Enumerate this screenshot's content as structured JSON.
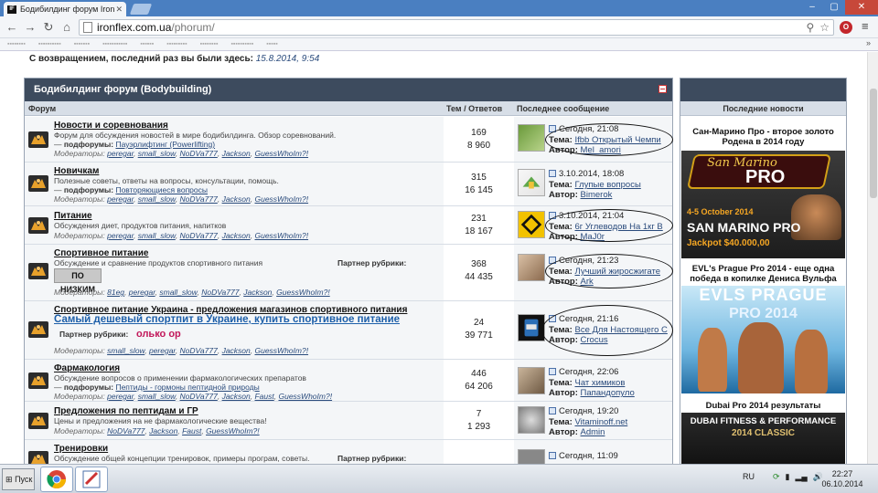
{
  "browser": {
    "tab_title": "Бодибилдинг форум IronFle",
    "url_host": "ironflex.com.ua",
    "url_path": "/phorum/"
  },
  "page": {
    "welcome": "С возвращением, последний раз вы были здесь:",
    "last_visit": "15.8.2014, 9:54",
    "section_title": "Бодибилдинг форум (Bodybuilding)",
    "col_forum": "Форум",
    "col_stats": "Тем / Ответов",
    "col_last": "Последнее сообщение",
    "topic_label": "Тема:",
    "author_label": "Автор:",
    "subforums_label": "подфорумы:",
    "moderators_label": "Модераторы:",
    "partner_label": "Партнер рубрики:"
  },
  "forums": [
    {
      "name": "Новости и соревнования",
      "desc": "Форум для обсуждения новостей в мире бодибилдинга. Обзор соревнований.",
      "subforum": "Пауэрлифтинг (Powerlifting)",
      "mods": [
        "peregar",
        "small_slow",
        "NoDVa777",
        "Jackson",
        "GuessWhoIm?!"
      ],
      "topics": "169",
      "replies": "8 960",
      "last_time": "Сегодня, 21:08",
      "last_topic": "Ifbb Открытый Чемпи",
      "last_author": "Mel_amori"
    },
    {
      "name": "Новичкам",
      "desc": "Полезные советы, ответы на вопросы, консультации, помощь.",
      "subforum": "Повторяющиеся вопросы",
      "mods": [
        "peregar",
        "small_slow",
        "NoDVa777",
        "Jackson",
        "GuessWhoIm?!"
      ],
      "topics": "315",
      "replies": "16 145",
      "last_time": "3.10.2014, 18:08",
      "last_topic": "Глупые вопросы",
      "last_author": "Bimerok"
    },
    {
      "name": "Питание",
      "desc": "Обсуждения диет, продуктов питания, напитков",
      "mods": [
        "peregar",
        "small_slow",
        "NoDVa777",
        "Jackson",
        "GuessWhoIm?!"
      ],
      "topics": "231",
      "replies": "18 167",
      "last_time": "3.10.2014, 21:04",
      "last_topic": "6г Углеводов На 1кг В",
      "last_author": "MaJ0r"
    },
    {
      "name": "Спортивное питание",
      "desc": "Обсуждение и сравнение продуктов спортивного питания",
      "partner_img": "ПО НИЗКИМ",
      "mods": [
        "81eg",
        "peregar",
        "small_slow",
        "NoDVa777",
        "Jackson",
        "GuessWhoIm?!"
      ],
      "topics": "368",
      "replies": "44 435",
      "last_time": "Сегодня, 21:23",
      "last_topic": "Лучший жиросжигате",
      "last_author": "Ark"
    },
    {
      "name": "Спортивное питание Украина - предложения магазинов спортивного питания",
      "promo": "Самый дешевый спортпит в Украине, купить спортивное питание",
      "partner_text": "олько ор",
      "mods": [
        "small_slow",
        "peregar",
        "NoDVa777",
        "Jackson",
        "GuessWhoIm?!"
      ],
      "topics": "24",
      "replies": "39 771",
      "last_time": "Сегодня, 21:16",
      "last_topic": "Все Для Настоящего С",
      "last_author": "Crocus"
    },
    {
      "name": "Фармакология",
      "desc": "Обсуждение вопросов о применении фармакологических препаратов",
      "subforum": "Пептиды - гормоны пептидной природы",
      "mods": [
        "peregar",
        "small_slow",
        "NoDVa777",
        "Jackson",
        "Faust",
        "GuessWhoIm?!"
      ],
      "topics": "446",
      "replies": "64 206",
      "last_time": "Сегодня, 22:06",
      "last_topic": "Чат химиков",
      "last_author": "Папандопуло"
    },
    {
      "name": "Предложения по пептидам и ГР",
      "desc": "Цены и предложения на не фармакологические вещества!",
      "mods": [
        "NoDVa777",
        "Jackson",
        "Faust",
        "GuessWhoIm?!"
      ],
      "topics": "7",
      "replies": "1 293",
      "last_time": "Сегодня, 19:20",
      "last_topic": "Vitaminoff.net",
      "last_author": "Admin"
    },
    {
      "name": "Тренировки",
      "desc": "Обсуждение общей концепции тренировок, примеры програм, советы.",
      "topics": "",
      "last_time": "Сегодня, 11:09"
    }
  ],
  "news": {
    "header": "Последние новости",
    "item1": "Сан-Марино Про - второе золото Родена в 2014 году",
    "banner1_brand": "San Marino",
    "banner1_title": "PRO",
    "banner1_date": "4-5 October 2014",
    "banner1_place": "SAN MARINO PRO",
    "banner1_prize": "Jackpot $40.000,00",
    "item2": "EVL's Prague Pro 2014 - еще одна победа в копилке Дениса Вульфа",
    "banner2_title": "EVLS PRAGUE",
    "banner2_sub": "PRO 2014",
    "item3": "Dubai Pro 2014 результаты",
    "banner3_line1": "DUBAI FITNESS & PERFORMANCE",
    "banner3_line2": "2014 CLASSIC"
  },
  "taskbar": {
    "start": "Пуск",
    "lang": "RU",
    "time": "22:27",
    "date": "06.10.2014"
  }
}
